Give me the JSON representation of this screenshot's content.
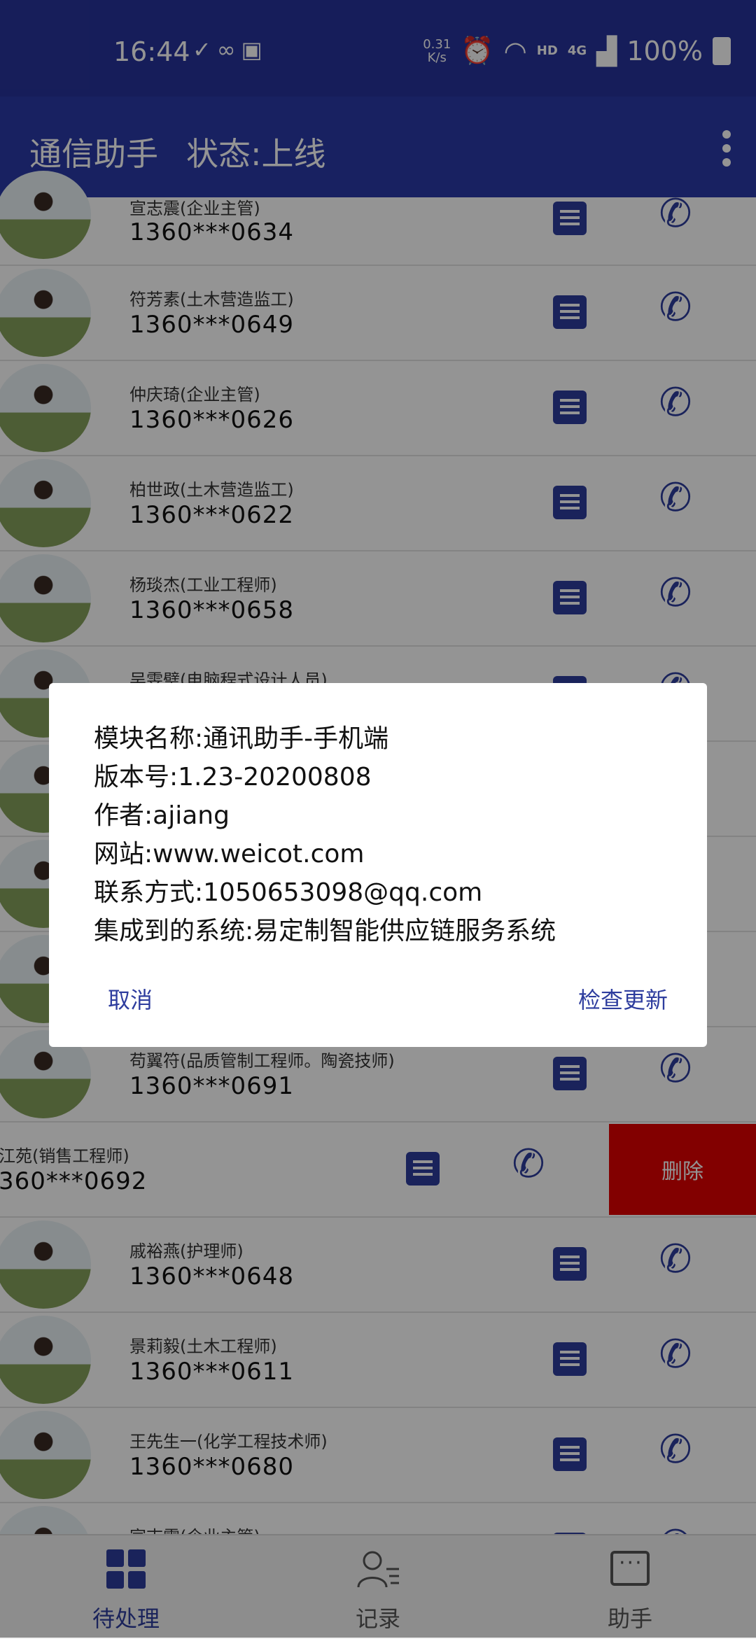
{
  "status_bar": {
    "time": "16:44",
    "net_speed_value": "0.31",
    "net_speed_unit": "K/s",
    "hd": "HD",
    "network": "4G",
    "battery": "100%",
    "left_icons": [
      "tick-icon",
      "link-icon",
      "image-icon"
    ],
    "right_icons": [
      "alarm-icon",
      "wifi-icon",
      "signal-icon",
      "battery-icon"
    ]
  },
  "app_bar": {
    "title": "通信助手",
    "status": "状态:上线"
  },
  "contacts": [
    {
      "name": "宣志震(企业主管)",
      "phone": "1360***0634"
    },
    {
      "name": "符芳素(土木营造监工)",
      "phone": "1360***0649"
    },
    {
      "name": "仲庆琦(企业主管)",
      "phone": "1360***0626"
    },
    {
      "name": "柏世政(土木营造监工)",
      "phone": "1360***0622"
    },
    {
      "name": "杨琰杰(工业工程师)",
      "phone": "1360***0658"
    },
    {
      "name": "吴雯璧(电脑程式设计人员)",
      "phone": ""
    },
    {
      "name": "",
      "phone": ""
    },
    {
      "name": "",
      "phone": ""
    },
    {
      "name": "",
      "phone": ""
    },
    {
      "name": "苟翼符(品质管制工程师。陶瓷技师)",
      "phone": "1360***0691"
    },
    {
      "name": "江苑(销售工程师)",
      "phone": "360***0692",
      "swiped": true,
      "delete_label": "删除"
    },
    {
      "name": "戚裕燕(护理师)",
      "phone": "1360***0648"
    },
    {
      "name": "景莉毅(土木工程师)",
      "phone": "1360***0611"
    },
    {
      "name": "王先生一(化学工程技术师)",
      "phone": "1360***0680"
    },
    {
      "name": "宣志震(企业主管)",
      "phone": ""
    }
  ],
  "dialog": {
    "lines": [
      "模块名称:通讯助手-手机端",
      "版本号:1.23-20200808",
      "作者:ajiang",
      "网站:www.weicot.com",
      "联系方式:1050653098@qq.com",
      "集成到的系统:易定制智能供应链服务系统"
    ],
    "cancel_label": "取消",
    "update_label": "检查更新"
  },
  "bottom_nav": [
    {
      "label": "待处理",
      "icon": "grid-icon",
      "active": true
    },
    {
      "label": "记录",
      "icon": "person-list-icon",
      "active": false
    },
    {
      "label": "助手",
      "icon": "chat-icon",
      "active": false
    }
  ],
  "colors": {
    "primary": "#2a3aa7",
    "icon": "#2e3d9e",
    "delete": "#e00000"
  }
}
